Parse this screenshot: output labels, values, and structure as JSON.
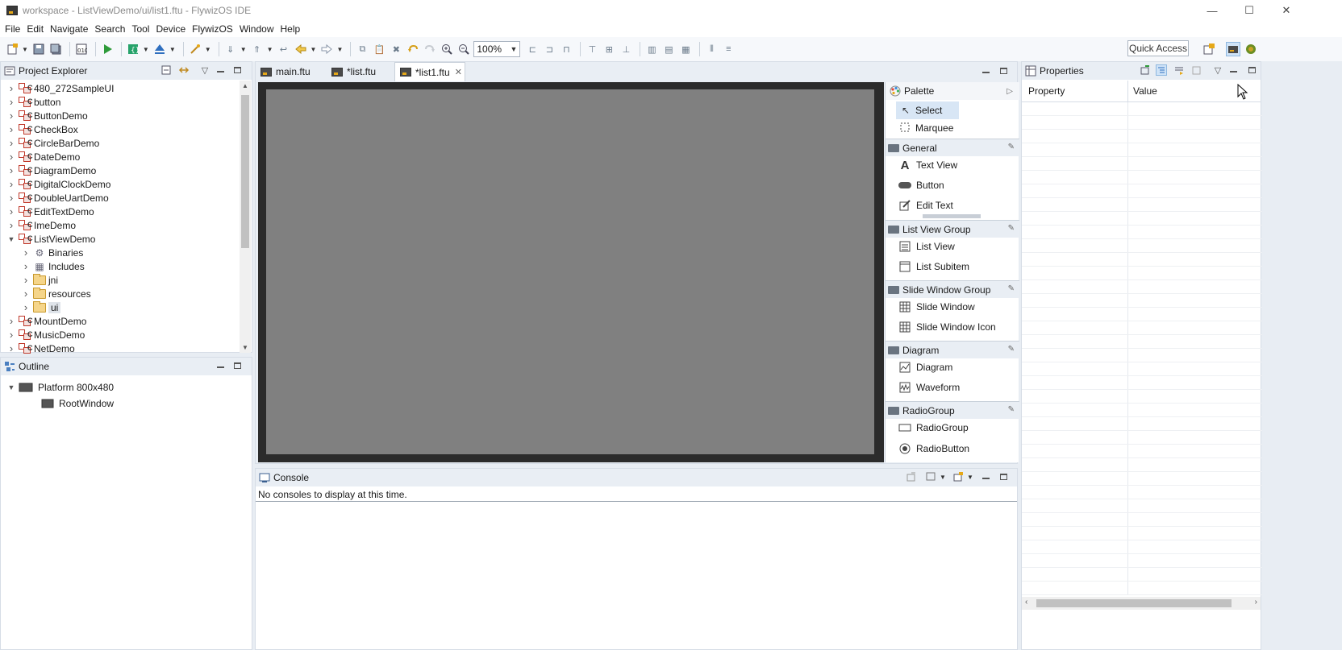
{
  "window": {
    "title": "workspace - ListViewDemo/ui/list1.ftu - FlywizOS IDE",
    "min_symbol": "—",
    "max_symbol": "☐",
    "close_symbol": "✕"
  },
  "menu": [
    "File",
    "Edit",
    "Navigate",
    "Search",
    "Tool",
    "Device",
    "FlywizOS",
    "Window",
    "Help"
  ],
  "toolbar": {
    "zoom_value": "100%",
    "quick_access_label": "Quick Access"
  },
  "project_explorer": {
    "title": "Project Explorer",
    "items": [
      {
        "label": "480_272SampleUI",
        "type": "project",
        "expanded": false
      },
      {
        "label": "button",
        "type": "project",
        "expanded": false
      },
      {
        "label": "ButtonDemo",
        "type": "project",
        "expanded": false
      },
      {
        "label": "CheckBox",
        "type": "project",
        "expanded": false
      },
      {
        "label": "CircleBarDemo",
        "type": "project",
        "expanded": false
      },
      {
        "label": "DateDemo",
        "type": "project",
        "expanded": false
      },
      {
        "label": "DiagramDemo",
        "type": "project",
        "expanded": false
      },
      {
        "label": "DigitalClockDemo",
        "type": "project",
        "expanded": false
      },
      {
        "label": "DoubleUartDemo",
        "type": "project",
        "expanded": false
      },
      {
        "label": "EditTextDemo",
        "type": "project",
        "expanded": false
      },
      {
        "label": "ImeDemo",
        "type": "project",
        "expanded": false
      },
      {
        "label": "ListViewDemo",
        "type": "project",
        "expanded": true
      },
      {
        "label": "Binaries",
        "type": "binaries",
        "child": true
      },
      {
        "label": "Includes",
        "type": "includes",
        "child": true
      },
      {
        "label": "jni",
        "type": "folder",
        "child": true
      },
      {
        "label": "resources",
        "type": "folder",
        "child": true
      },
      {
        "label": "ui",
        "type": "folder",
        "child": true,
        "selected": true
      },
      {
        "label": "MountDemo",
        "type": "project",
        "expanded": false
      },
      {
        "label": "MusicDemo",
        "type": "project",
        "expanded": false
      },
      {
        "label": "NetDemo",
        "type": "project",
        "expanded": false
      }
    ]
  },
  "outline": {
    "title": "Outline",
    "root": "Platform 800x480",
    "child": "RootWindow"
  },
  "editor": {
    "tabs": [
      {
        "label": "main.ftu",
        "active": false
      },
      {
        "label": "*list.ftu",
        "active": false
      },
      {
        "label": "*list1.ftu",
        "active": true
      }
    ],
    "canvas_color": "#808080"
  },
  "palette": {
    "title": "Palette",
    "tools": [
      "Select",
      "Marquee"
    ],
    "sections": [
      {
        "name": "General",
        "items": [
          "Text View",
          "Button",
          "Edit Text"
        ]
      },
      {
        "name": "List View Group",
        "items": [
          "List View",
          "List Subitem"
        ]
      },
      {
        "name": "Slide Window Group",
        "items": [
          "Slide Window",
          "Slide Window Icon"
        ]
      },
      {
        "name": "Diagram",
        "items": [
          "Diagram",
          "Waveform"
        ]
      },
      {
        "name": "RadioGroup",
        "items": [
          "RadioGroup",
          "RadioButton"
        ]
      }
    ]
  },
  "console": {
    "title": "Console",
    "message": "No consoles to display at this time."
  },
  "properties": {
    "title": "Properties",
    "col_property": "Property",
    "col_value": "Value"
  }
}
